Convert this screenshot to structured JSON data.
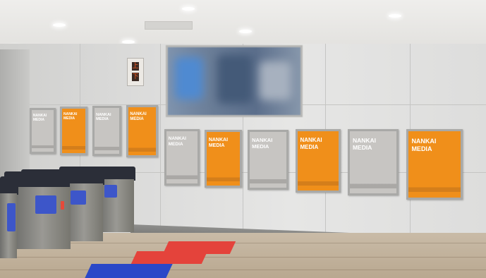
{
  "scene": {
    "description_label": "",
    "station_sign": {
      "glyph_up": "上",
      "glyph_down": "下"
    },
    "posters": [
      {
        "text": "NANKAI MEDIA",
        "color": "gray"
      },
      {
        "text": "NANKAI MEDIA",
        "color": "orange"
      },
      {
        "text": "NANKAI MEDIA",
        "color": "gray"
      },
      {
        "text": "NANKAI MEDIA",
        "color": "orange"
      },
      {
        "text": "NANKAI MEDIA",
        "color": "gray"
      },
      {
        "text": "NANKAI MEDIA",
        "color": "orange"
      },
      {
        "text": "NANKAI MEDIA",
        "color": "gray"
      },
      {
        "text": "NANKAI MEDIA",
        "color": "orange"
      },
      {
        "text": "NANKAI MEDIA",
        "color": "gray"
      },
      {
        "text": "NANKAI MEDIA",
        "color": "orange"
      }
    ],
    "colors": {
      "orange": "#f08f1a",
      "gray": "#c7c5c2",
      "gate_panel": "#3d56c9"
    }
  }
}
